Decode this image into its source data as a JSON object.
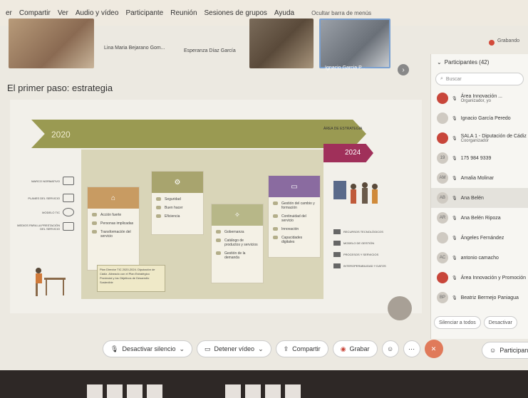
{
  "menubar": {
    "items": [
      "er",
      "Compartir",
      "Ver",
      "Audio y vídeo",
      "Participante",
      "Reunión",
      "Sesiones de grupos",
      "Ayuda"
    ],
    "hide_bar_label": "Ocultar barra de menús"
  },
  "thumbnails": {
    "names": [
      "Lina Maria Bejarano Gom...",
      "Esperanza Díaz García",
      "Ignacio Garcia P..."
    ],
    "recording_label": "Grabando"
  },
  "slide": {
    "title": "El primer paso: estrategia",
    "timeline_start": "2020",
    "timeline_end": "2024",
    "timeline_caption": "ÁREA DE ESTRATEGIA",
    "cards": [
      {
        "color": "#c89b62",
        "rows": [
          "Acción fuerte",
          "Personas implicadas",
          "Transformación del servicio"
        ]
      },
      {
        "color": "#a8a46e",
        "rows": [
          "Seguridad",
          "Buen hacer",
          "Eficiencia"
        ]
      },
      {
        "color": "#b7b788",
        "rows": [
          "Gobernanza",
          "Catálogo de productos y servicios",
          "Gestión de la demanda"
        ]
      },
      {
        "color": "#8a6ba0",
        "rows": [
          "Gestión del cambio y formación",
          "Continuidad del servicio",
          "Innovación",
          "Capacidades digitales"
        ]
      }
    ],
    "side_labels": [
      "MARCO NORMATIVO",
      "PLANES DEL SERVICIO",
      "MODELO TIC",
      "MEDIOS PARA LA PRESTACIÓN DEL SERVICIO"
    ],
    "bubble_text": "Plan Director TIC 2020-2024. Diputación de Cádiz. Alineado con el Plan Estratégico Provincial y los Objetivos de Desarrollo Sostenible",
    "legend": [
      "RECURSOS TECNOLÓGICOS",
      "MODELO DE GESTIÓN",
      "PROCESOS Y SERVICIOS",
      "INTEROPERABILIDAD Y DATOS"
    ]
  },
  "participants": {
    "header": "Participantes (42)",
    "search_placeholder": "Buscar",
    "list": [
      {
        "name": "Área Innovación ...",
        "sub": "Organizador, yo",
        "avatar": "",
        "red": true,
        "sel": false
      },
      {
        "name": "Ignacio García Peredo",
        "sub": "",
        "avatar": "",
        "red": false,
        "sel": false
      },
      {
        "name": "SALA 1 - Diputación de Cádiz",
        "sub": "Coorganizador",
        "avatar": "",
        "red": true,
        "sel": false
      },
      {
        "name": "175 984 9339",
        "sub": "",
        "avatar": "19",
        "red": false,
        "sel": false
      },
      {
        "name": "Amalia Molinar",
        "sub": "",
        "avatar": "AM",
        "red": false,
        "sel": false
      },
      {
        "name": "Ana Belén",
        "sub": "",
        "avatar": "AB",
        "red": false,
        "sel": true
      },
      {
        "name": "Ana Belén Ripoza",
        "sub": "",
        "avatar": "AR",
        "red": false,
        "sel": false
      },
      {
        "name": "Ángeles Fernández",
        "sub": "",
        "avatar": "",
        "red": false,
        "sel": false
      },
      {
        "name": "antonio camacho",
        "sub": "",
        "avatar": "AC",
        "red": false,
        "sel": false
      },
      {
        "name": "Área Innovación y Promoción",
        "sub": "",
        "avatar": "",
        "red": true,
        "sel": false
      },
      {
        "name": "Beatriz Bermejo Paniagua",
        "sub": "",
        "avatar": "BP",
        "red": false,
        "sel": false
      }
    ],
    "mute_all": "Silenciar a todos",
    "unmute": "Desactivar"
  },
  "controls": {
    "unmute": "Desactivar silencio",
    "stop_video": "Detener vídeo",
    "share": "Compartir",
    "record": "Grabar",
    "participants": "Participantes"
  },
  "colors": {
    "timeline": "#9a9a52",
    "accent_red": "#c8463a",
    "leave": "#e07a5a"
  }
}
